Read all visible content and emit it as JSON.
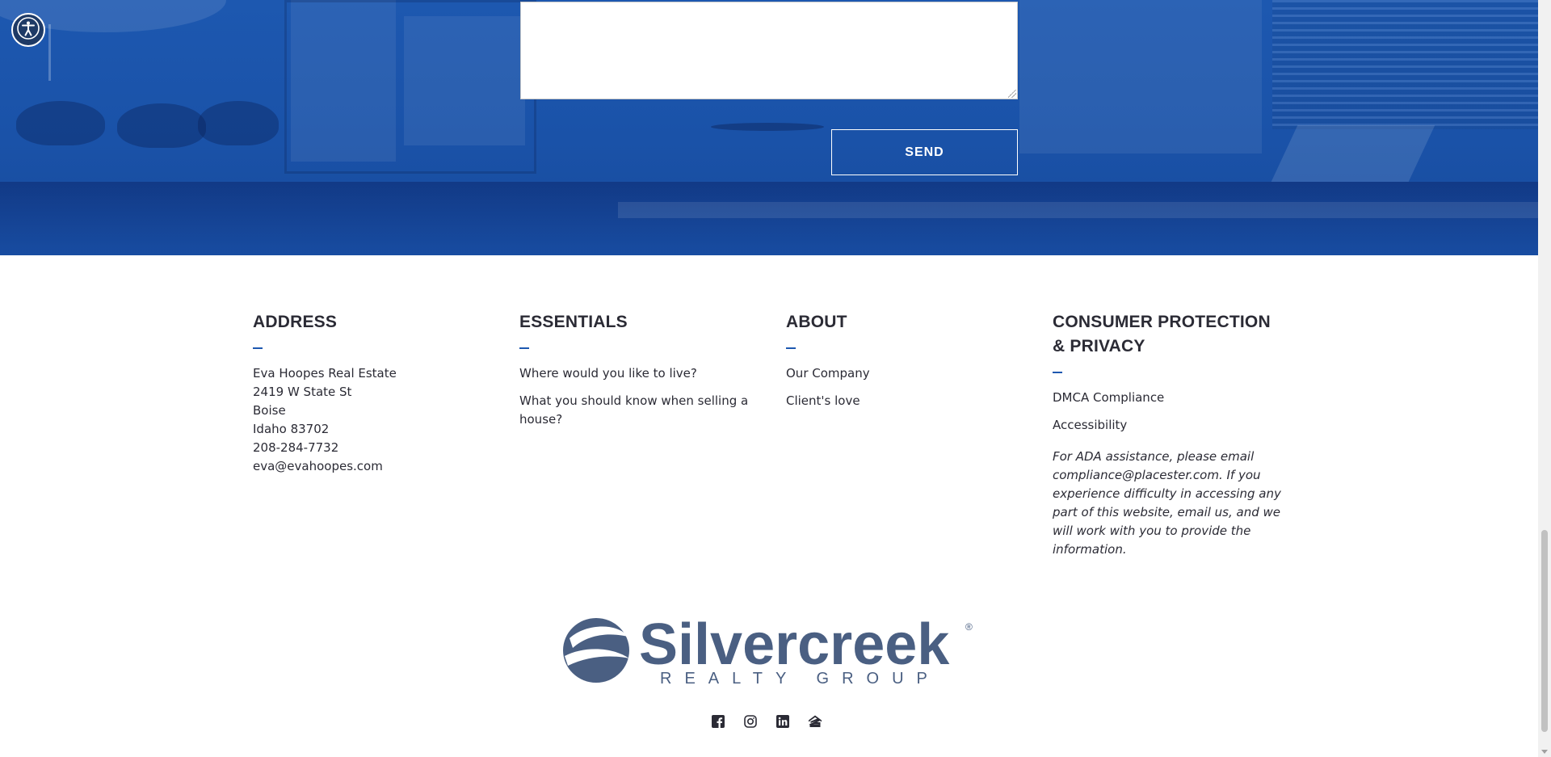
{
  "contact": {
    "message_value": "",
    "send_label": "SEND"
  },
  "footer": {
    "address": {
      "heading": "ADDRESS",
      "lines": [
        "Eva Hoopes Real Estate",
        "2419 W State St",
        "Boise",
        "Idaho 83702",
        "208-284-7732",
        "eva@evahoopes.com"
      ]
    },
    "essentials": {
      "heading": "ESSENTIALS",
      "links": [
        "Where would you like to live?",
        "What you should know when selling a house?"
      ]
    },
    "about": {
      "heading": "ABOUT",
      "links": [
        "Our Company",
        "Client's love"
      ]
    },
    "consumer": {
      "heading": "CONSUMER PROTECTION & PRIVACY",
      "links": [
        "DMCA Compliance",
        "Accessibility"
      ],
      "note": "For ADA assistance, please email compliance@placester.com. If you experience difficulty in accessing any part of this website, email us, and we will work with you to provide the information."
    }
  },
  "logo": {
    "name": "Silvercreek",
    "tagline": "REALTY GROUP",
    "registered": "®"
  },
  "social_icons": [
    "facebook-icon",
    "instagram-icon",
    "linkedin-icon",
    "zillow-icon"
  ],
  "colors": {
    "hero_blue": "#1d58b0",
    "accent_blue": "#1d58b0",
    "text_dark": "#2b2b35",
    "logo_slate": "#4a5f82"
  }
}
